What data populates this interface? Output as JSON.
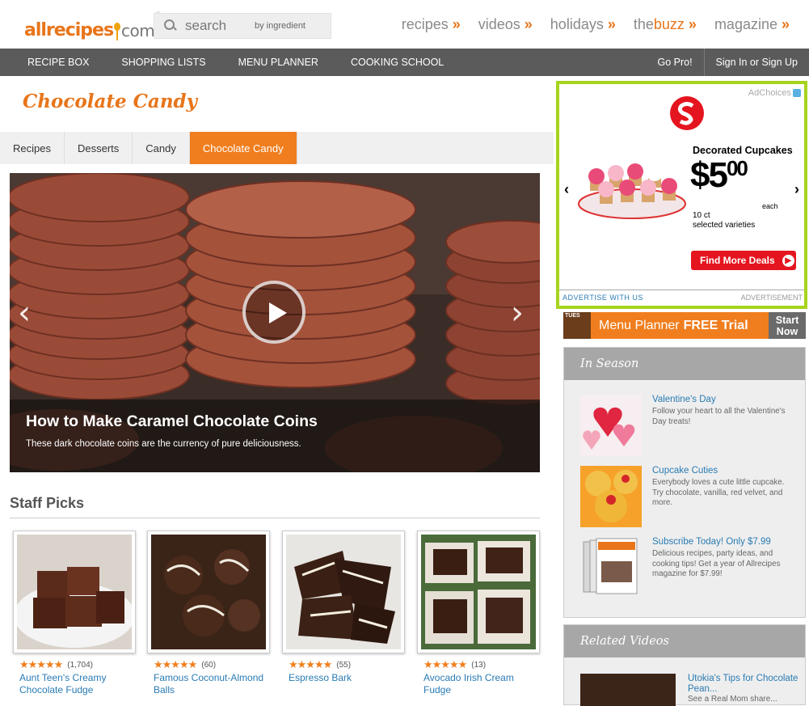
{
  "header": {
    "logo_brand": "allrecipes",
    "logo_dotcom": "com",
    "logo_tm": "®",
    "search_placeholder": "search",
    "search_by_ingredient": "by ingredient",
    "top_nav": [
      {
        "label": "recipes",
        "raquo": "»"
      },
      {
        "label": "videos",
        "raquo": "»"
      },
      {
        "label": "holidays",
        "raquo": "»"
      },
      {
        "label_pre": "the",
        "label_post": "buzz",
        "raquo": "»"
      },
      {
        "label": "magazine",
        "raquo": "»"
      }
    ]
  },
  "main_nav": {
    "left": [
      "RECIPE BOX",
      "SHOPPING LISTS",
      "MENU PLANNER",
      "COOKING SCHOOL"
    ],
    "right": [
      "Go Pro!",
      "Sign In or Sign Up"
    ]
  },
  "page": {
    "title": "Chocolate Candy",
    "breadcrumbs": [
      "Recipes",
      "Desserts",
      "Candy",
      "Chocolate Candy"
    ],
    "active_breadcrumb_index": 3
  },
  "hero": {
    "title": "How to Make Caramel Chocolate Coins",
    "subtitle": "These dark chocolate coins are the currency of pure deliciousness.",
    "prev_arrow": "‹",
    "next_arrow": "›"
  },
  "staff_picks": {
    "heading": "Staff Picks",
    "items": [
      {
        "name": "Aunt Teen's Creamy Chocolate Fudge",
        "stars": "★★★★★",
        "count": "(1,704)",
        "rating": 4.5
      },
      {
        "name": "Famous Coconut-Almond Balls",
        "stars": "★★★★★",
        "count": "(60)",
        "rating": 4.5
      },
      {
        "name": "Espresso Bark",
        "stars": "★★★★★",
        "count": "(55)",
        "rating": 4.5
      },
      {
        "name": "Avocado Irish Cream Fudge",
        "stars": "★★★★★",
        "count": "(13)",
        "rating": 4.0
      }
    ]
  },
  "ad": {
    "adchoices": "AdChoices",
    "headline": "Decorated Cupcakes",
    "price_dollar": "$5",
    "price_cents": "00",
    "each": "each",
    "qty_line1": "10 ct",
    "qty_line2": "selected varieties",
    "cta": "Find More Deals",
    "advertise": "ADVERTISE WITH US",
    "label": "ADVERTISEMENT",
    "nav_prev": "‹",
    "nav_next": "›",
    "brand_color": "#e4151f"
  },
  "menu_planner_banner": {
    "tues": "TUES",
    "text": "Menu Planner",
    "free_trial": "FREE Trial",
    "start_line1": "Start",
    "start_line2": "Now"
  },
  "in_season": {
    "heading": "In Season",
    "items": [
      {
        "title": "Valentine's Day",
        "desc": "Follow your heart to all the Valentine's Day treats!"
      },
      {
        "title": "Cupcake Cuties",
        "desc": "Everybody loves a cute little cupcake. Try chocolate, vanilla, red velvet, and more."
      },
      {
        "title": "Subscribe Today! Only $7.99",
        "desc": "Delicious recipes, party ideas, and cooking tips! Get a year of Allrecipes magazine for $7.99!"
      }
    ]
  },
  "related_videos": {
    "heading": "Related Videos",
    "item_title": "Utokia's Tips for Chocolate Pean...",
    "item_sub": "See a Real Mom share..."
  },
  "colors": {
    "accent": "#e8751a",
    "nav_bg": "#5b5b5b",
    "link": "#2a7bb3",
    "ad_border": "#a6d41d"
  }
}
